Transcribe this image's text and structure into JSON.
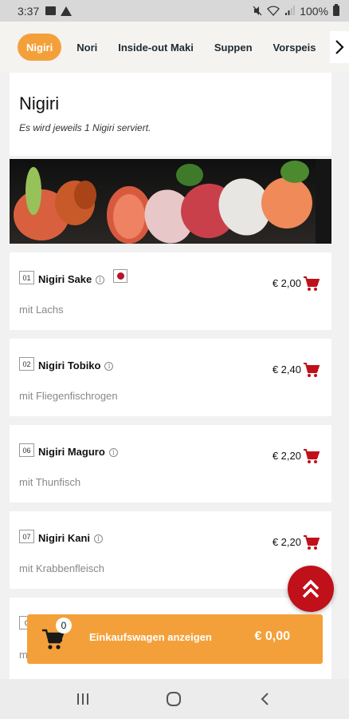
{
  "status_bar": {
    "time": "3:37",
    "battery": "100%",
    "left_icons": [
      "image-icon",
      "warning-icon"
    ],
    "right_icons": [
      "mute-icon",
      "wifi-icon",
      "signal-icon",
      "battery-icon"
    ]
  },
  "tabs": {
    "items": [
      {
        "label": "Nigiri",
        "active": true
      },
      {
        "label": "Nori",
        "active": false
      },
      {
        "label": "Inside-out Maki",
        "active": false
      },
      {
        "label": "Suppen",
        "active": false
      },
      {
        "label": "Vorspeis",
        "active": false
      }
    ],
    "next_icon": "chevron-right-icon"
  },
  "category": {
    "title": "Nigiri",
    "description": "Es wird jeweils 1 Nigiri serviert."
  },
  "items": [
    {
      "number": "01",
      "name": "Nigiri Sake",
      "description": "mit Lachs",
      "price": "€ 2,00",
      "flag": true
    },
    {
      "number": "02",
      "name": "Nigiri Tobiko",
      "description": "mit Fliegenfischrogen",
      "price": "€ 2,40",
      "flag": false
    },
    {
      "number": "06",
      "name": "Nigiri Maguro",
      "description": "mit Thunfisch",
      "price": "€ 2,20",
      "flag": false
    },
    {
      "number": "07",
      "name": "Nigiri Kani",
      "description": "mit Krabbenfleisch",
      "price": "€ 2,20",
      "flag": false
    },
    {
      "number": "0",
      "name": "",
      "description": "m",
      "price": "",
      "flag": false
    }
  ],
  "cart_bar": {
    "count": "0",
    "label": "Einkaufswagen anzeigen",
    "total": "€ 0,00"
  },
  "colors": {
    "accent_orange": "#f4a03a",
    "accent_red": "#c0101a",
    "cart_icon_red": "#c0101a"
  }
}
